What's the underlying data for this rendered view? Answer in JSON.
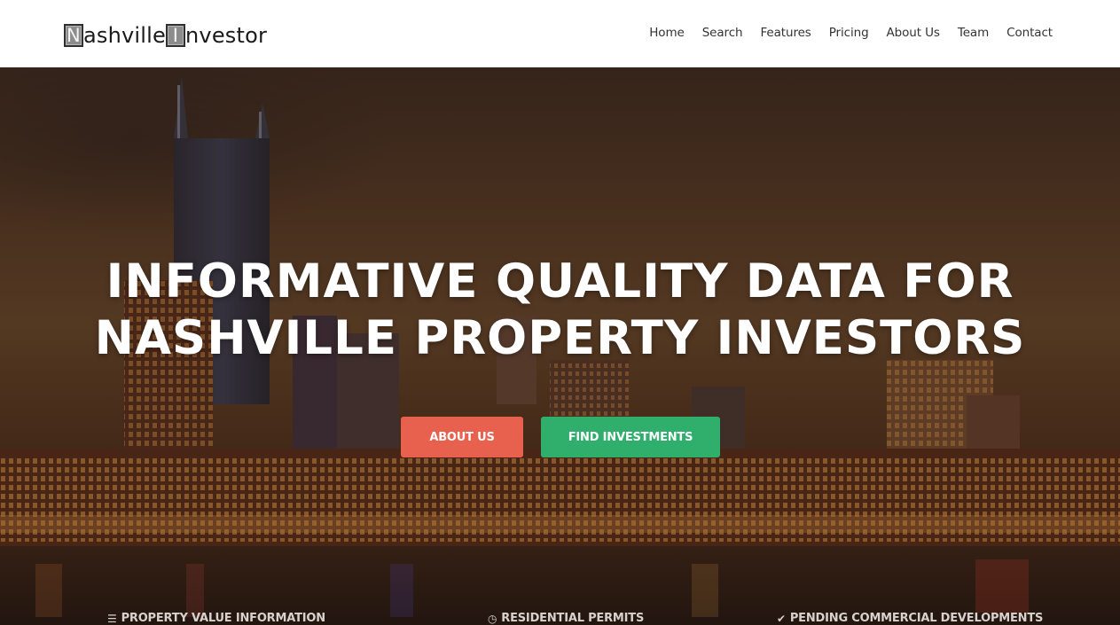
{
  "brand": {
    "letter1": "N",
    "word1": "ashville",
    "letter2": "I",
    "word2": "nvestor"
  },
  "nav": {
    "items": [
      "Home",
      "Search",
      "Features",
      "Pricing",
      "About Us",
      "Team",
      "Contact"
    ]
  },
  "hero": {
    "title_line1": "INFORMATIVE QUALITY DATA FOR",
    "title_line2": "NASHVILLE PROPERTY INVESTORS",
    "about_button": "ABOUT US",
    "find_button": "FIND INVESTMENTS",
    "colors": {
      "about": "#e8604e",
      "find": "#2fae6c"
    }
  },
  "features": [
    {
      "icon": "list-icon",
      "label": "PROPERTY VALUE INFORMATION"
    },
    {
      "icon": "clock-icon",
      "label": "RESIDENTIAL PERMITS"
    },
    {
      "icon": "checkmark-icon",
      "label": "PENDING COMMERCIAL DEVELOPMENTS"
    }
  ]
}
